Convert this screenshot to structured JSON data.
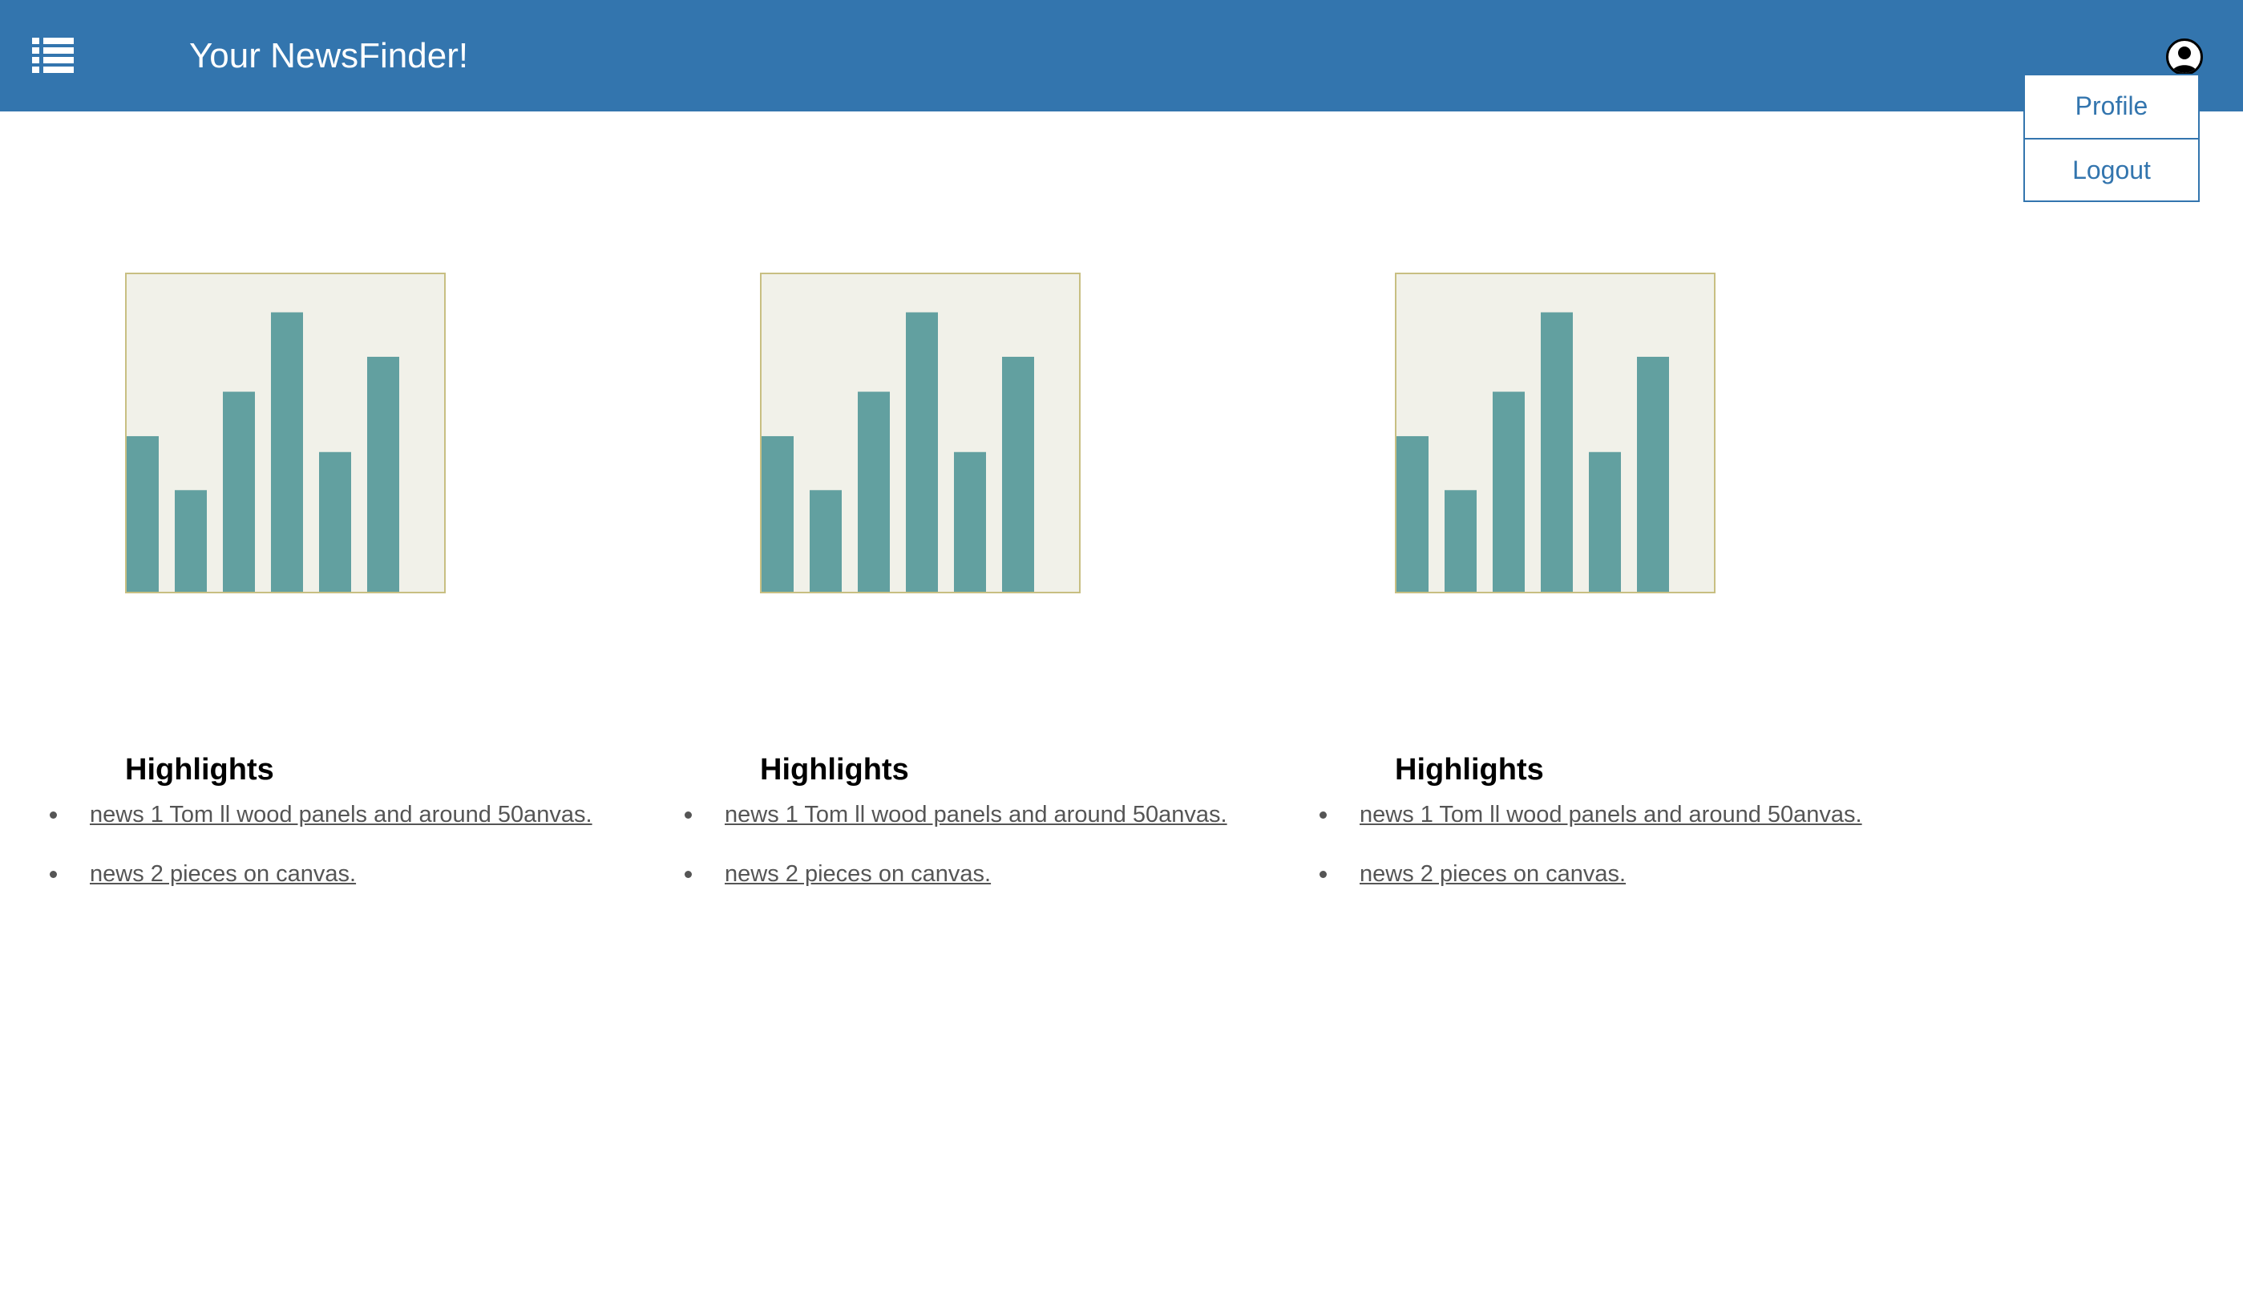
{
  "header": {
    "title": "Your NewsFinder!",
    "background": "#3375ae",
    "menu_icon": "list-menu-icon",
    "account_icon": "user-avatar-icon"
  },
  "account_menu": {
    "items": [
      {
        "label": "Profile"
      },
      {
        "label": "Logout"
      }
    ]
  },
  "cards": [
    {
      "chart_icon": "bar-chart-image",
      "title": "Highlights",
      "news": [
        {
          "label": "news 1 Tom ll wood panels and around 50anvas."
        },
        {
          "label": "news 2 pieces on canvas."
        }
      ]
    },
    {
      "chart_icon": "bar-chart-image",
      "title": "Highlights",
      "news": [
        {
          "label": "news 1 Tom ll wood panels and around 50anvas."
        },
        {
          "label": "news 2 pieces on canvas."
        }
      ]
    },
    {
      "chart_icon": "bar-chart-image",
      "title": "Highlights",
      "news": [
        {
          "label": "news 1 Tom ll wood panels and around 50anvas."
        },
        {
          "label": "news 2 pieces on canvas."
        }
      ]
    }
  ],
  "chart_data": {
    "type": "bar",
    "categories": [
      "",
      "",
      "",
      "",
      "",
      ""
    ],
    "values": [
      49,
      32,
      63,
      88,
      44,
      74
    ],
    "ylim": [
      0,
      100
    ],
    "grid": false,
    "bar_color": "#62a0a0",
    "background": "#f1f1e9",
    "border_color": "#c8bf82"
  }
}
